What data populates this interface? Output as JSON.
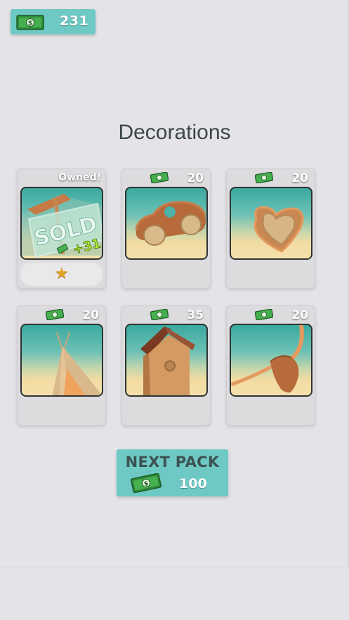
{
  "wallet": {
    "amount": "231",
    "icon": "cash-icon"
  },
  "page": {
    "title": "Decorations"
  },
  "items": [
    {
      "name": "sold-sign",
      "status": "Owned!",
      "owned": true,
      "badge": "SOLD",
      "bonus": "+31"
    },
    {
      "name": "toy-car",
      "price": "20",
      "owned": false
    },
    {
      "name": "heart-bowl",
      "price": "20",
      "owned": false
    },
    {
      "name": "teepee",
      "price": "20",
      "owned": false
    },
    {
      "name": "birdhouse",
      "price": "35",
      "owned": false
    },
    {
      "name": "bull-skull",
      "price": "20",
      "owned": false
    }
  ],
  "next_pack": {
    "label": "NEXT PACK",
    "cost": "100"
  },
  "colors": {
    "accent": "#6ec9c4",
    "background": "#e4e3e7",
    "star": "#e2a52b"
  }
}
